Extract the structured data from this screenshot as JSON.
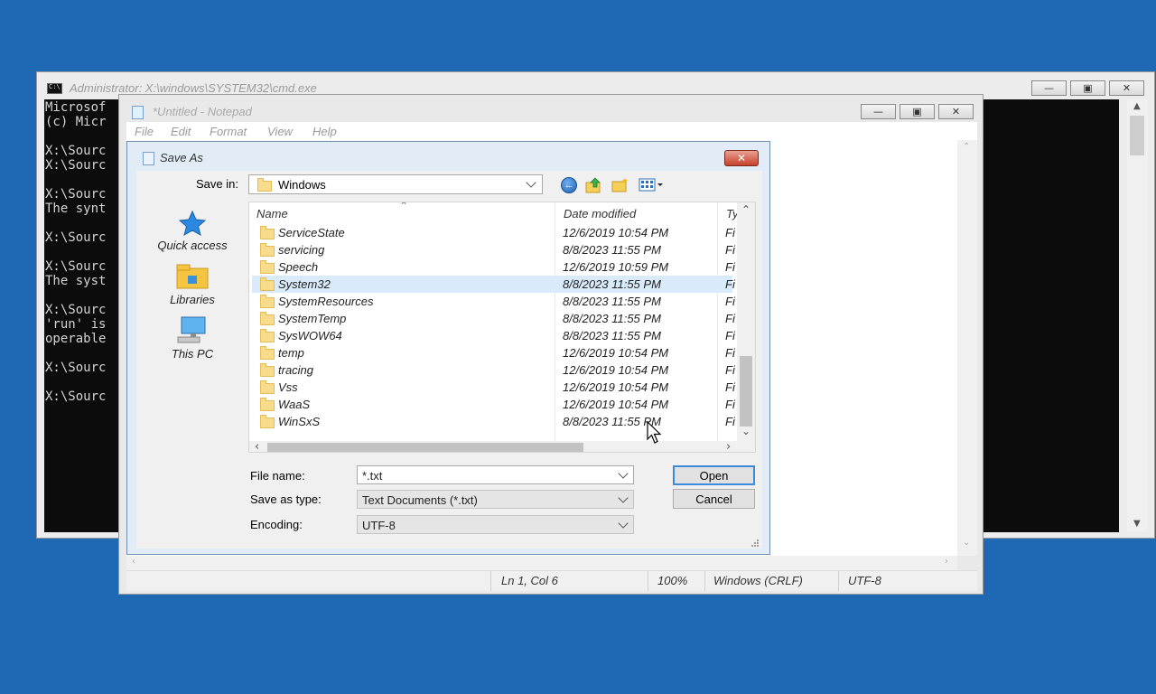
{
  "cmd": {
    "title": "Administrator: X:\\windows\\SYSTEM32\\cmd.exe",
    "lines": [
      "Microsof",
      "(c) Micr",
      "",
      "X:\\Sourc",
      "X:\\Sourc",
      "",
      "X:\\Sourc",
      "The synt",
      "",
      "X:\\Sourc",
      "",
      "X:\\Sourc",
      "The syst",
      "",
      "X:\\Sourc",
      "'run' is",
      "operable",
      "",
      "X:\\Sourc",
      "",
      "X:\\Sourc"
    ]
  },
  "notepad": {
    "title": "*Untitled - Notepad",
    "menu": [
      "File",
      "Edit",
      "Format",
      "View",
      "Help"
    ],
    "status": {
      "position": "Ln 1, Col 6",
      "zoom": "100%",
      "line_ending": "Windows (CRLF)",
      "encoding": "UTF-8"
    }
  },
  "dialog": {
    "title": "Save As",
    "save_in_label": "Save in:",
    "save_in_value": "Windows",
    "places": [
      "Quick access",
      "Libraries",
      "This PC"
    ],
    "columns": {
      "name": "Name",
      "date": "Date modified",
      "type": "Ty"
    },
    "files": [
      {
        "name": "ServiceState",
        "date": "12/6/2019 10:54 PM",
        "type": "Fi"
      },
      {
        "name": "servicing",
        "date": "8/8/2023 11:55 PM",
        "type": "Fi"
      },
      {
        "name": "Speech",
        "date": "12/6/2019 10:59 PM",
        "type": "Fi"
      },
      {
        "name": "System32",
        "date": "8/8/2023 11:55 PM",
        "type": "Fi"
      },
      {
        "name": "SystemResources",
        "date": "8/8/2023 11:55 PM",
        "type": "Fi"
      },
      {
        "name": "SystemTemp",
        "date": "8/8/2023 11:55 PM",
        "type": "Fi"
      },
      {
        "name": "SysWOW64",
        "date": "8/8/2023 11:55 PM",
        "type": "Fi"
      },
      {
        "name": "temp",
        "date": "12/6/2019 10:54 PM",
        "type": "Fi"
      },
      {
        "name": "tracing",
        "date": "12/6/2019 10:54 PM",
        "type": "Fi"
      },
      {
        "name": "Vss",
        "date": "12/6/2019 10:54 PM",
        "type": "Fi"
      },
      {
        "name": "WaaS",
        "date": "12/6/2019 10:54 PM",
        "type": "Fi"
      },
      {
        "name": "WinSxS",
        "date": "8/8/2023 11:55 PM",
        "type": "Fi"
      }
    ],
    "selected_index": 3,
    "file_name_label": "File name:",
    "file_name_value": "*.txt",
    "save_type_label": "Save as type:",
    "save_type_value": "Text Documents (*.txt)",
    "encoding_label": "Encoding:",
    "encoding_value": "UTF-8",
    "open_label": "Open",
    "cancel_label": "Cancel"
  },
  "colors": {
    "desktop": "#1f68b3",
    "selection": "#d9ebfb",
    "default_button_border": "#3c8bd9"
  }
}
